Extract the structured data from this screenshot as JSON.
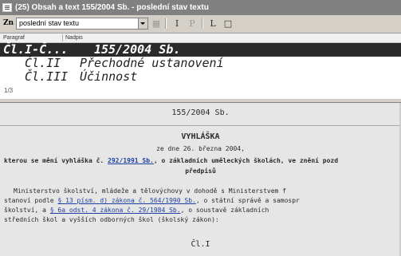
{
  "window": {
    "title": "(25) Obsah a text 155/2004 Sb. - poslední stav textu"
  },
  "toolbar": {
    "zn_label": "Zn",
    "view_select_value": "poslední stav textu",
    "buttons": [
      {
        "name": "print-preview",
        "label": "▦"
      },
      {
        "name": "italic-i",
        "label": "I"
      },
      {
        "name": "paragraph-p",
        "label": "P"
      },
      {
        "name": "link-l",
        "label": "L"
      },
      {
        "name": "window",
        "label": "□"
      }
    ]
  },
  "outline": {
    "columns": [
      "Paragraf",
      "Nadpis"
    ],
    "rows": [
      {
        "paragraf": "Čl.I-Č...",
        "nadpis": "155/2004 Sb."
      },
      {
        "paragraf": "Čl.II",
        "nadpis": "Přechodné ustanovení"
      },
      {
        "paragraf": "Čl.III",
        "nadpis": "Účinnost"
      }
    ],
    "counter": "1/3"
  },
  "document": {
    "number": "155/2004 Sb.",
    "kind": "VYHLÁŠKA",
    "date": "ze dne 26. března 2004,",
    "title_prefix": "kterou se mění vyhláška č. ",
    "title_link": "292/1991 Sb.",
    "title_suffix": ", o základních uměleckých školách, ve znění pozd",
    "title_line2": "předpisů",
    "body": {
      "l1": "Ministerstvo školství, mládeže a tělovýchovy v dohodě s Ministerstvem f",
      "l2_a": "stanoví podle ",
      "l2_link1": "§ 13 písm. d) zákona č. 564/1990 Sb.",
      "l2_b": ", o státní správě a samospr",
      "l3_a": "školství, a ",
      "l3_link": "§ 6a odst. 4 zákona č. 29/1984 Sb.",
      "l3_b": ", o soustavě základních",
      "l4": "středních škol a vyšších odborných škol (školský zákon):"
    },
    "section_heading": "Čl.I"
  },
  "colors": {
    "titlebar": "#808080",
    "selected_row": "#2a2a2a",
    "link": "#1f3fa0",
    "document_bg": "#e6e6e6"
  }
}
